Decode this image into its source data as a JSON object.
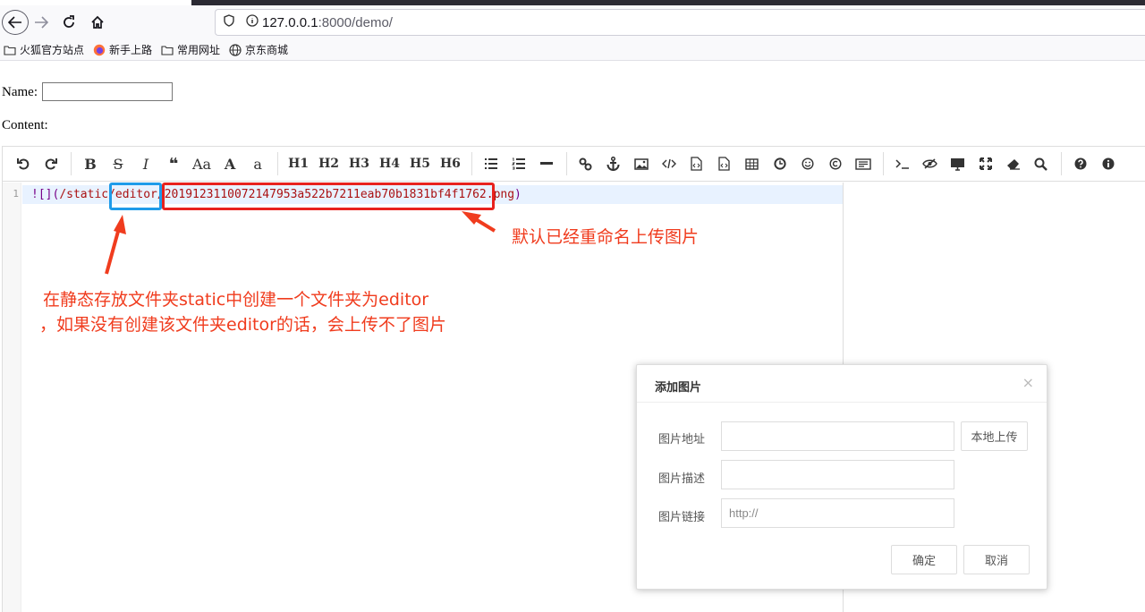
{
  "browser": {
    "url_host": "127.0.0.1",
    "url_rest": ":8000/demo/",
    "bookmarks": [
      {
        "label": "火狐官方站点",
        "icon": "folder-icon"
      },
      {
        "label": "新手上路",
        "icon": "firefox-icon"
      },
      {
        "label": "常用网址",
        "icon": "folder-icon"
      },
      {
        "label": "京东商城",
        "icon": "globe-icon"
      }
    ]
  },
  "form": {
    "name_label": "Name:",
    "name_value": "",
    "content_label": "Content:"
  },
  "editor": {
    "toolbar": {
      "bold": "B",
      "strike": "S",
      "italic": "I",
      "quote": "❝",
      "case_upper": "Aa",
      "upper": "A",
      "lower": "a",
      "headings": [
        "H1",
        "H2",
        "H3",
        "H4",
        "H5",
        "H6"
      ]
    },
    "line_number": "1",
    "code_markup": "![](",
    "code_path": "/static/editor/20191231100721479 53a522b7211eab70b1831bf4f1762.png",
    "code_parts": {
      "prefix": "![](",
      "path": "/static/editor/2019123110072147953a522b7211eab70b1831bf4f1762.png",
      "suffix": ")"
    }
  },
  "annotations": {
    "renamed_note": "默认已经重命名上传图片",
    "folder_note_line1": "在静态存放文件夹static中创建一个文件夹为editor",
    "folder_note_line2": "，如果没有创建该文件夹editor的话，会上传不了图片",
    "colors": {
      "red": "#e8221d",
      "blue": "#1e9be9",
      "text": "#f03c1e"
    }
  },
  "dialog": {
    "title": "添加图片",
    "close": "×",
    "fields": [
      {
        "label": "图片地址",
        "value": "",
        "placeholder": ""
      },
      {
        "label": "图片描述",
        "value": "",
        "placeholder": ""
      },
      {
        "label": "图片链接",
        "value": "http://",
        "placeholder": ""
      }
    ],
    "upload_button": "本地上传",
    "ok_button": "确定",
    "cancel_button": "取消"
  }
}
